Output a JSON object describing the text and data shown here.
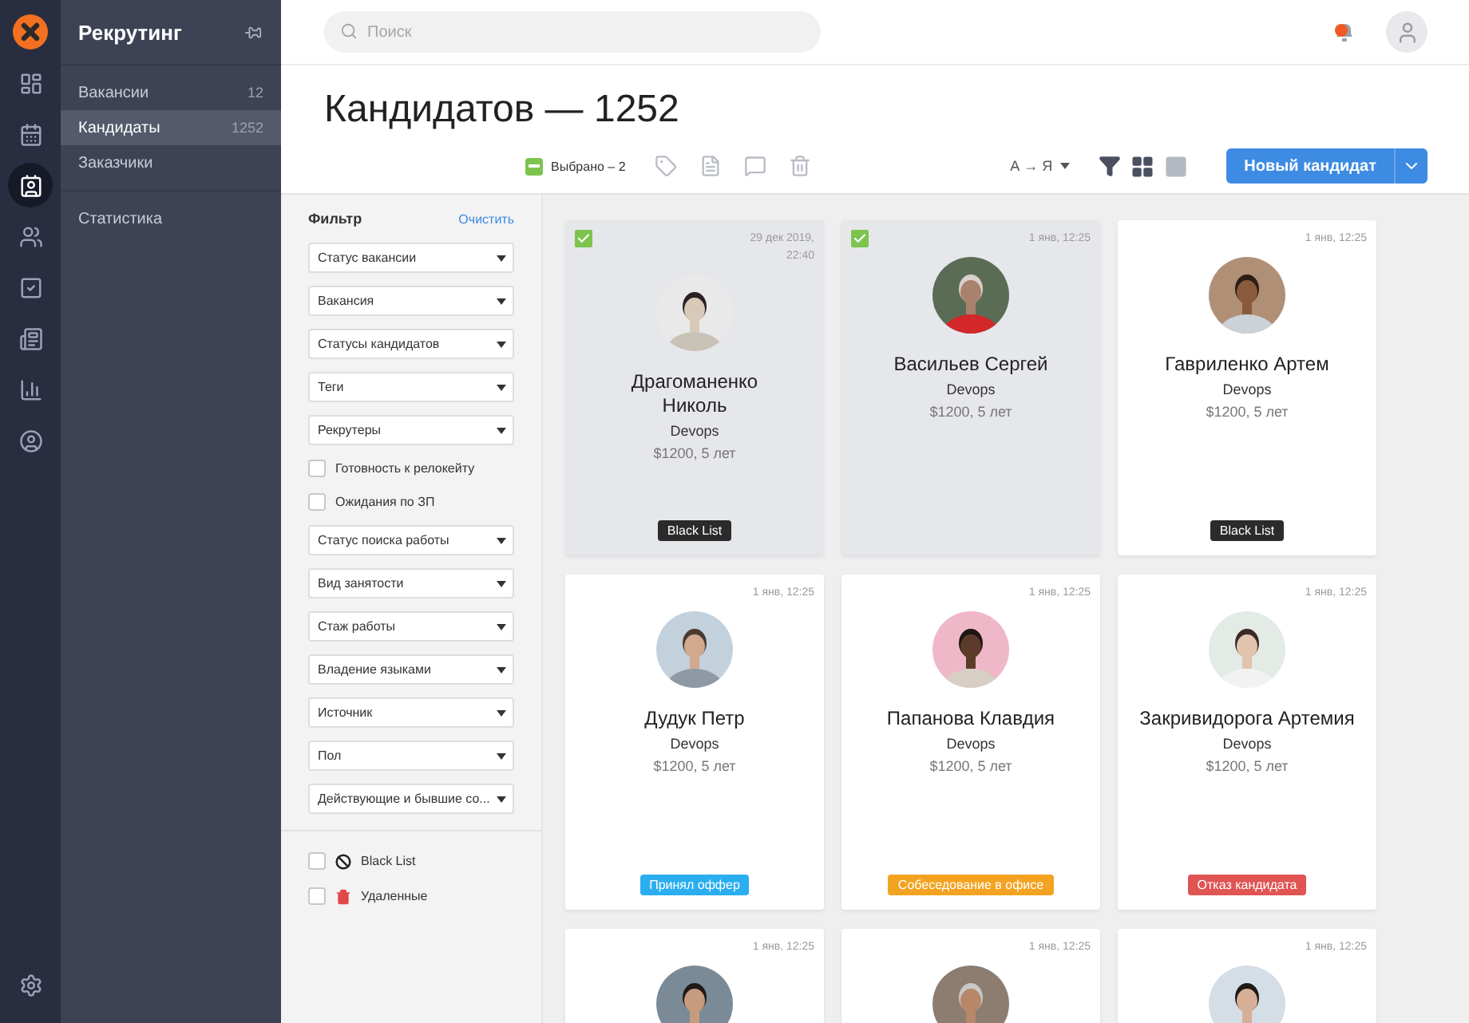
{
  "rail": {
    "items": [
      {
        "kind": "dashboard",
        "selected": false
      },
      {
        "kind": "calendar",
        "selected": false
      },
      {
        "kind": "contacts",
        "selected": true
      },
      {
        "kind": "team",
        "selected": false
      },
      {
        "kind": "tasks",
        "selected": false
      },
      {
        "kind": "docs",
        "selected": false
      },
      {
        "kind": "stats",
        "selected": false
      },
      {
        "kind": "profile",
        "selected": false
      }
    ]
  },
  "nav": {
    "title": "Рекрутинг",
    "items": [
      {
        "label": "Вакансии",
        "count": "12",
        "selected": false
      },
      {
        "label": "Кандидаты",
        "count": "1252",
        "selected": true
      },
      {
        "label": "Заказчики",
        "selected": false
      }
    ],
    "items_2": [
      {
        "label": "Статистика",
        "selected": false
      }
    ]
  },
  "search": {
    "placeholder": "Поиск"
  },
  "title": "Кандидатов — 1252",
  "toolbar": {
    "selection_partial": true,
    "selection_label": "Выбрано – 2",
    "sort": "А → Я",
    "views": [
      {
        "kind": "grid",
        "selected": true
      },
      {
        "kind": "list",
        "selected": false
      }
    ],
    "new_button": "Новый кандидат"
  },
  "filter": {
    "title": "Фильтр",
    "clear": "Очистить",
    "fields": [
      {
        "kind": "select",
        "label": "Статус вакансии"
      },
      {
        "kind": "select",
        "label": "Вакансия"
      },
      {
        "kind": "select",
        "label": "Статусы кандидатов"
      },
      {
        "kind": "select",
        "label": "Теги"
      },
      {
        "kind": "select",
        "label": "Рекрутеры"
      },
      {
        "kind": "checkbox",
        "label": "Готовность к релокейту",
        "checked": false
      },
      {
        "kind": "checkbox",
        "label": "Ожидания по ЗП",
        "checked": false
      },
      {
        "kind": "select",
        "label": "Статус поиска работы"
      },
      {
        "kind": "select",
        "label": "Вид занятости"
      },
      {
        "kind": "select",
        "label": "Стаж работы"
      },
      {
        "kind": "select",
        "label": "Владение языками"
      },
      {
        "kind": "select",
        "label": "Источник"
      },
      {
        "kind": "select",
        "label": "Пол"
      },
      {
        "kind": "select",
        "label": "Действующие и бывшие со..."
      }
    ],
    "extras": [
      {
        "kind": "blacklist",
        "label": "Black List",
        "checked": false
      },
      {
        "kind": "deleted",
        "label": "Удаленные",
        "checked": false
      }
    ]
  },
  "cards": [
    {
      "selected": true,
      "date": "29 дек 2019, 22:40",
      "name": "Драгоманенко Николь",
      "role": "Devops",
      "salary": "$1200, 5 лет",
      "tag": {
        "label": "Black List",
        "color": "#2b2b2b"
      }
    },
    {
      "selected": true,
      "date": "1 янв, 12:25",
      "name": "Васильев Сергей",
      "role": "Devops",
      "salary": "$1200, 5 лет"
    },
    {
      "selected": false,
      "date": "1 янв, 12:25",
      "name": "Гавриленко Артем",
      "role": "Devops",
      "salary": "$1200, 5 лет",
      "tag": {
        "label": "Black List",
        "color": "#2b2b2b"
      }
    },
    {
      "selected": false,
      "date": "1 янв, 12:25",
      "name": "Дудук Петр",
      "role": "Devops",
      "salary": "$1200, 5 лет",
      "tag": {
        "label": "Принял оффер",
        "color": "#2aaef0"
      }
    },
    {
      "selected": false,
      "date": "1 янв, 12:25",
      "name": "Папанова Клавдия",
      "role": "Devops",
      "salary": "$1200, 5 лет",
      "tag": {
        "label": "Собеседование в офисе",
        "color": "#f3a321"
      }
    },
    {
      "selected": false,
      "date": "1 янв, 12:25",
      "name": "Закривидорога Артемия",
      "role": "Devops",
      "salary": "$1200, 5 лет",
      "tag": {
        "label": "Отказ кандидата",
        "color": "#e05454"
      }
    },
    {
      "selected": false,
      "date": "1 янв, 12:25"
    },
    {
      "selected": false,
      "date": "1 янв, 12:25"
    },
    {
      "selected": false,
      "date": "1 янв, 12:25"
    }
  ]
}
